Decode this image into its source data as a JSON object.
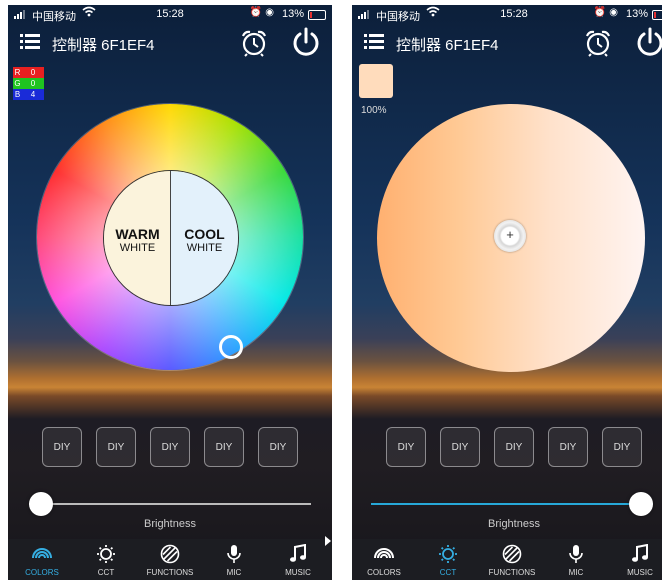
{
  "left_screen": {
    "status": {
      "carrier": "中国移动",
      "time": "15:28",
      "battery": "13%"
    },
    "header": {
      "title": "控制器 6F1EF4",
      "menu_icon": "list-icon",
      "alarm_icon": "alarm-clock-icon",
      "power_icon": "power-icon"
    },
    "rgb": {
      "r_label": "R",
      "r_value": "0",
      "g_label": "G",
      "g_value": "0",
      "b_label": "B",
      "b_value": "4"
    },
    "wheel": {
      "warm_main": "WARM",
      "warm_sub": "WHITE",
      "cool_main": "COOL",
      "cool_sub": "WHITE"
    },
    "diy": [
      "DIY",
      "DIY",
      "DIY",
      "DIY",
      "DIY"
    ],
    "brightness": {
      "label": "Brightness",
      "value": 0
    },
    "tabs": [
      {
        "label": "COLORS",
        "icon": "rainbow-icon",
        "active": true
      },
      {
        "label": "CCT",
        "icon": "sun-icon",
        "active": false
      },
      {
        "label": "FUNCTIONS",
        "icon": "striped-ball-icon",
        "active": false
      },
      {
        "label": "MIC",
        "icon": "microphone-icon",
        "active": false
      },
      {
        "label": "MUSIC",
        "icon": "music-note-icon",
        "active": false
      }
    ]
  },
  "right_screen": {
    "status": {
      "carrier": "中国移动",
      "time": "15:28",
      "battery": "13%"
    },
    "header": {
      "title": "控制器 6F1EF4",
      "menu_icon": "list-icon",
      "alarm_icon": "alarm-clock-icon",
      "power_icon": "power-icon"
    },
    "swatch": {
      "color": "#ffdcbc",
      "percent": "100%"
    },
    "diy": [
      "DIY",
      "DIY",
      "DIY",
      "DIY",
      "DIY"
    ],
    "brightness": {
      "label": "Brightness",
      "value": 1
    },
    "tabs": [
      {
        "label": "COLORS",
        "icon": "rainbow-icon",
        "active": false
      },
      {
        "label": "CCT",
        "icon": "sun-icon",
        "active": true
      },
      {
        "label": "FUNCTIONS",
        "icon": "striped-ball-icon",
        "active": false
      },
      {
        "label": "MIC",
        "icon": "microphone-icon",
        "active": false
      },
      {
        "label": "MUSIC",
        "icon": "music-note-icon",
        "active": false
      }
    ]
  },
  "colors": {
    "accent": "#35aee2",
    "red": "#e82020",
    "green": "#1fc41f",
    "blue": "#1a2bd8"
  }
}
